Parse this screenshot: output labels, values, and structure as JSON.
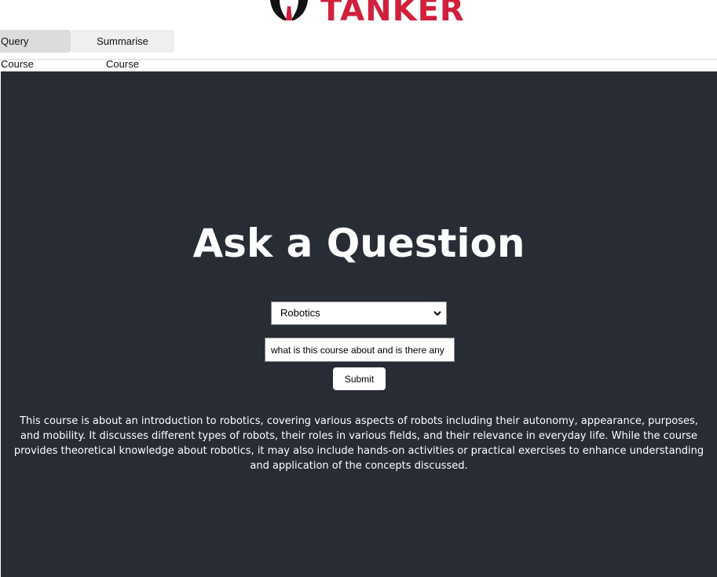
{
  "logo": {
    "text": "TANKER",
    "color": "#d21f3c"
  },
  "tabs": [
    {
      "label": "Query Course",
      "active": true
    },
    {
      "label": "Summarise Course",
      "active": false
    }
  ],
  "main": {
    "background": "#282c34",
    "heading": "Ask a Question",
    "course_select": {
      "selected": "Robotics",
      "icon": "chevron-down-icon"
    },
    "question_input": {
      "value": "what is this course about and is there any"
    },
    "submit_label": "Submit",
    "answer": "This course is about an introduction to robotics, covering various aspects of robots including their autonomy, appearance, purposes, and mobility. It discusses different types of robots, their roles in various fields, and their relevance in everyday life. While the course provides theoretical knowledge about robotics, it may also include hands-on activities or practical exercises to enhance understanding and application of the concepts discussed."
  }
}
